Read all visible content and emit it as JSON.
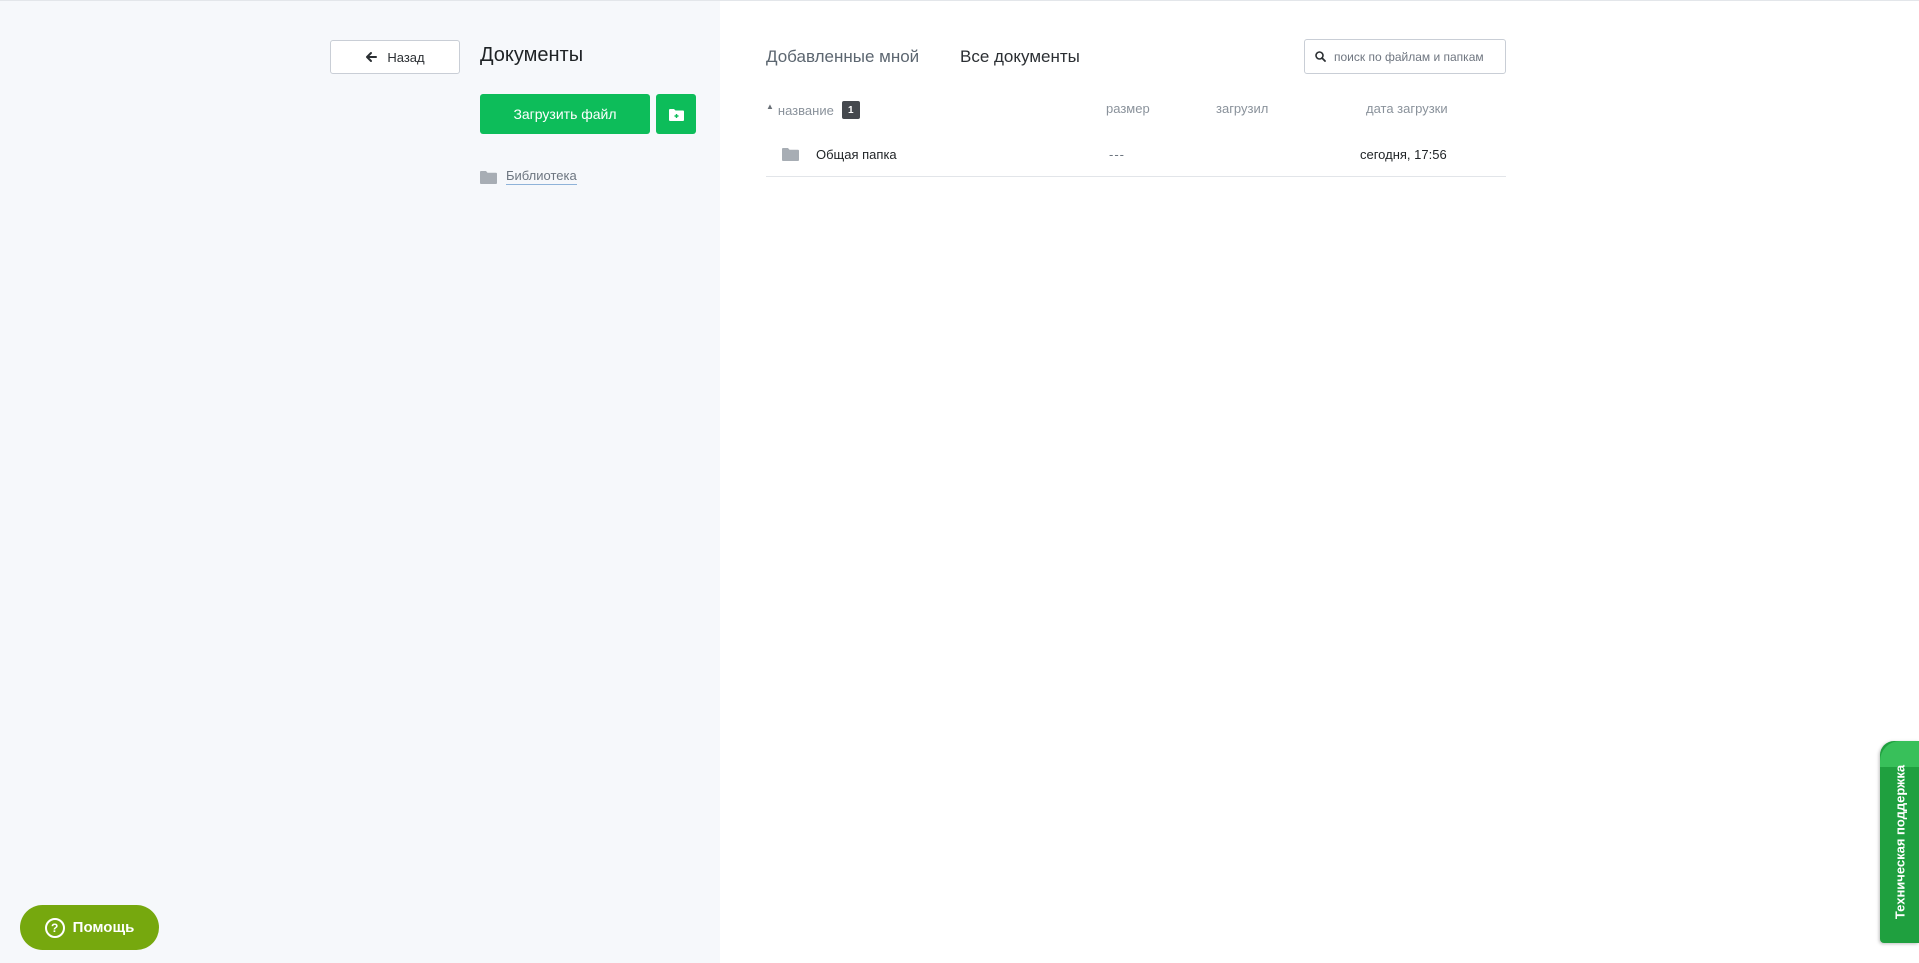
{
  "header": {
    "back_label": "Назад",
    "title": "Документы"
  },
  "sidebar": {
    "upload_label": "Загрузить файл",
    "library_label": "Библиотека"
  },
  "tabs": [
    {
      "label": "Добавленные мной",
      "active": false
    },
    {
      "label": "Все документы",
      "active": true
    }
  ],
  "search": {
    "placeholder": "поиск по файлам и папкам"
  },
  "table": {
    "columns": {
      "name": "название",
      "size": "размер",
      "uploader": "загрузил",
      "date": "дата загрузки"
    },
    "count": "1",
    "rows": [
      {
        "name": "Общая папка",
        "size": "---",
        "uploader": "",
        "date": "сегодня, 17:56",
        "icon": "folder-icon"
      }
    ]
  },
  "help": {
    "label": "Помощь",
    "icon_glyph": "?"
  },
  "support": {
    "label": "Техническая поддержка"
  },
  "colors": {
    "accent_green": "#0dbd5a",
    "help_green": "#76a80e",
    "support_green": "#1fa03f",
    "sidebar_bg": "#f6f8fb"
  }
}
